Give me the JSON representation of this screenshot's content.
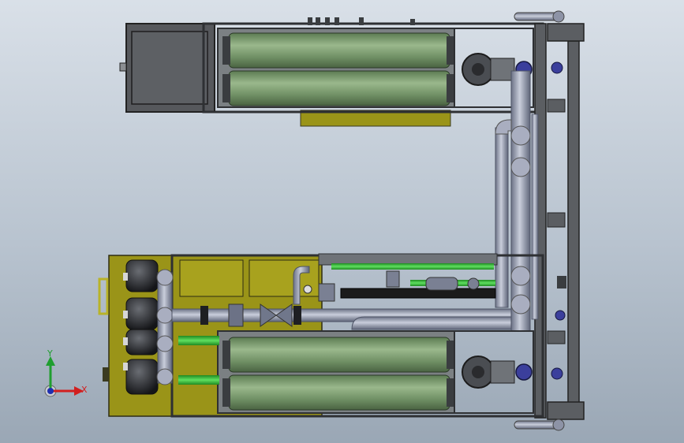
{
  "triad": {
    "x_label": "X",
    "y_label": "Y",
    "x_color": "#d21f1f",
    "y_color": "#1f9e2f",
    "origin_color": "#1f2fb0"
  },
  "palette": {
    "frame": "#5b5e62",
    "frame_dark": "#2e3033",
    "membrane": "#6f8f64",
    "membrane_light": "#97b38a",
    "base": "#9a9418",
    "base_light": "#b8b22b",
    "pipe": "#8d93a6",
    "pipe_dark": "#5f6579",
    "green_pipe": "#35b536",
    "black_pipe": "#1b1b1b",
    "valve_blue": "#3b3f9c",
    "panel_dark": "#56585c"
  }
}
